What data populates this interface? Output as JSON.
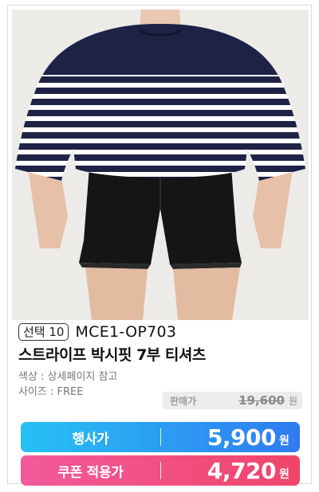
{
  "product": {
    "select_badge": "선택 10",
    "code": "MCE1-OP703",
    "title": "스트라이프 박시핏 7부 티셔츠",
    "color_info": "색상 : 상세페이지 참고",
    "size_info": "사이즈 : FREE",
    "list_price_label": "판매가",
    "list_price": "19,600",
    "list_price_unit": "원",
    "event_price_label": "행사가",
    "event_price": "5,900",
    "event_price_unit": "원",
    "coupon_price_label": "쿠폰 적용가",
    "coupon_price": "4,720",
    "coupon_price_unit": "원"
  },
  "colors": {
    "event_gradient_start": "#27c1f5",
    "event_gradient_end": "#2f7bf0",
    "coupon_gradient_start": "#f25a9b",
    "coupon_gradient_end": "#f0456a",
    "shirt_navy": "#1e2346"
  }
}
